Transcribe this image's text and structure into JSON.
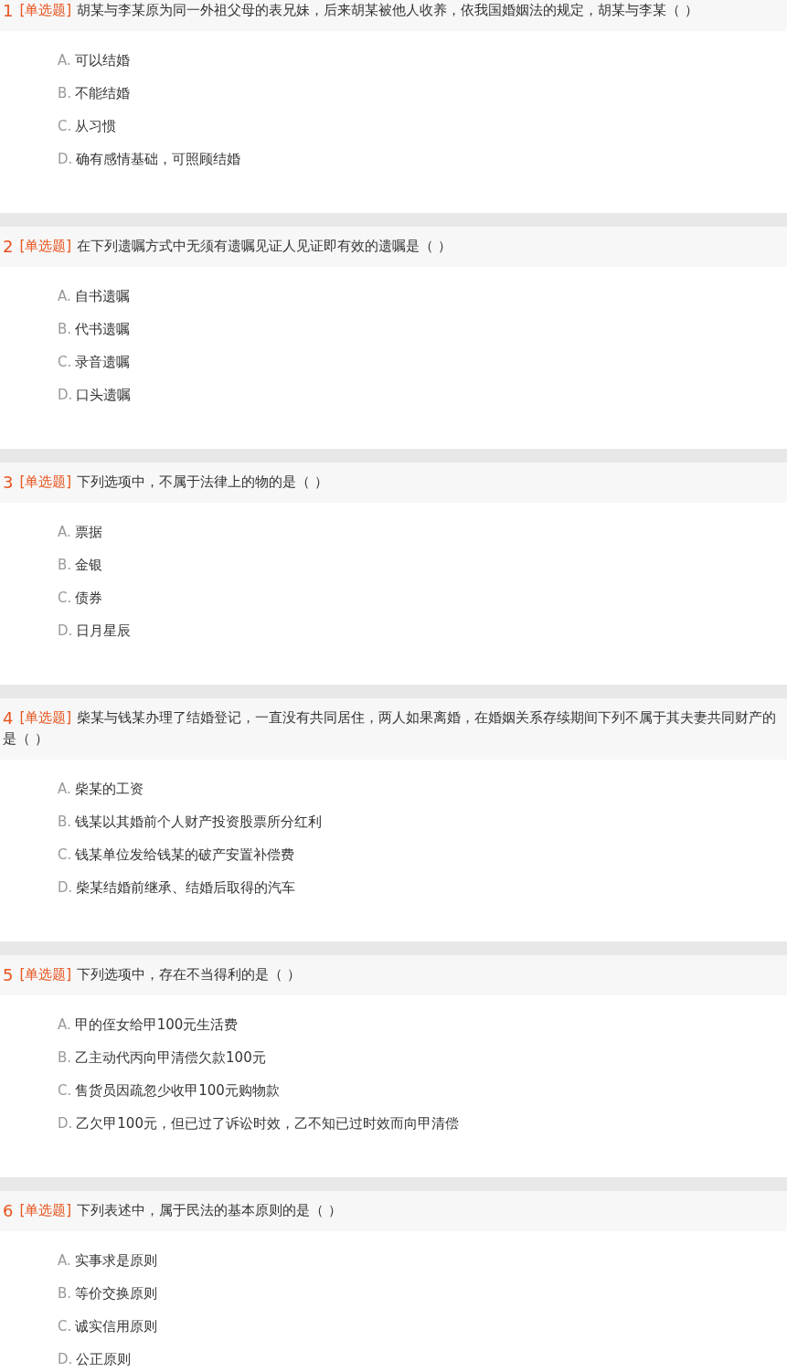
{
  "questions": [
    {
      "number": "1",
      "type": "[单选题]",
      "text": "胡某与李某原为同一外祖父母的表兄妹，后来胡某被他人收养，依我国婚姻法的规定，胡某与李某（ ）",
      "options": [
        {
          "letter": "A.",
          "text": "可以结婚"
        },
        {
          "letter": "B.",
          "text": "不能结婚"
        },
        {
          "letter": "C.",
          "text": "从习惯"
        },
        {
          "letter": "D.",
          "text": "确有感情基础，可照顾结婚"
        }
      ]
    },
    {
      "number": "2",
      "type": "[单选题]",
      "text": "在下列遗嘱方式中无须有遗嘱见证人见证即有效的遗嘱是（ ）",
      "options": [
        {
          "letter": "A.",
          "text": "自书遗嘱"
        },
        {
          "letter": "B.",
          "text": "代书遗嘱"
        },
        {
          "letter": "C.",
          "text": "录音遗嘱"
        },
        {
          "letter": "D.",
          "text": "口头遗嘱"
        }
      ]
    },
    {
      "number": "3",
      "type": "[单选题]",
      "text": "下列选项中，不属于法律上的物的是（ ）",
      "options": [
        {
          "letter": "A.",
          "text": "票据"
        },
        {
          "letter": "B.",
          "text": "金银"
        },
        {
          "letter": "C.",
          "text": "债券"
        },
        {
          "letter": "D.",
          "text": "日月星辰"
        }
      ]
    },
    {
      "number": "4",
      "type": "[单选题]",
      "text": "柴某与钱某办理了结婚登记，一直没有共同居住，两人如果离婚，在婚姻关系存续期间下列不属于其夫妻共同财产的是（ ）",
      "options": [
        {
          "letter": "A.",
          "text": "柴某的工资"
        },
        {
          "letter": "B.",
          "text": "钱某以其婚前个人财产投资股票所分红利"
        },
        {
          "letter": "C.",
          "text": "钱某单位发给钱某的破产安置补偿费"
        },
        {
          "letter": "D.",
          "text": "柴某结婚前继承、结婚后取得的汽车"
        }
      ]
    },
    {
      "number": "5",
      "type": "[单选题]",
      "text": "下列选项中，存在不当得利的是（ ）",
      "options": [
        {
          "letter": "A.",
          "text": "甲的侄女给甲100元生活费"
        },
        {
          "letter": "B.",
          "text": "乙主动代丙向甲清偿欠款100元"
        },
        {
          "letter": "C.",
          "text": "售货员因疏忽少收甲100元购物款"
        },
        {
          "letter": "D.",
          "text": "乙欠甲100元，但已过了诉讼时效，乙不知已过时效而向甲清偿"
        }
      ]
    },
    {
      "number": "6",
      "type": "[单选题]",
      "text": "下列表述中，属于民法的基本原则的是（ ）",
      "options": [
        {
          "letter": "A.",
          "text": "实事求是原则"
        },
        {
          "letter": "B.",
          "text": "等价交换原则"
        },
        {
          "letter": "C.",
          "text": "诚实信用原则"
        },
        {
          "letter": "D.",
          "text": "公正原则"
        }
      ]
    }
  ]
}
